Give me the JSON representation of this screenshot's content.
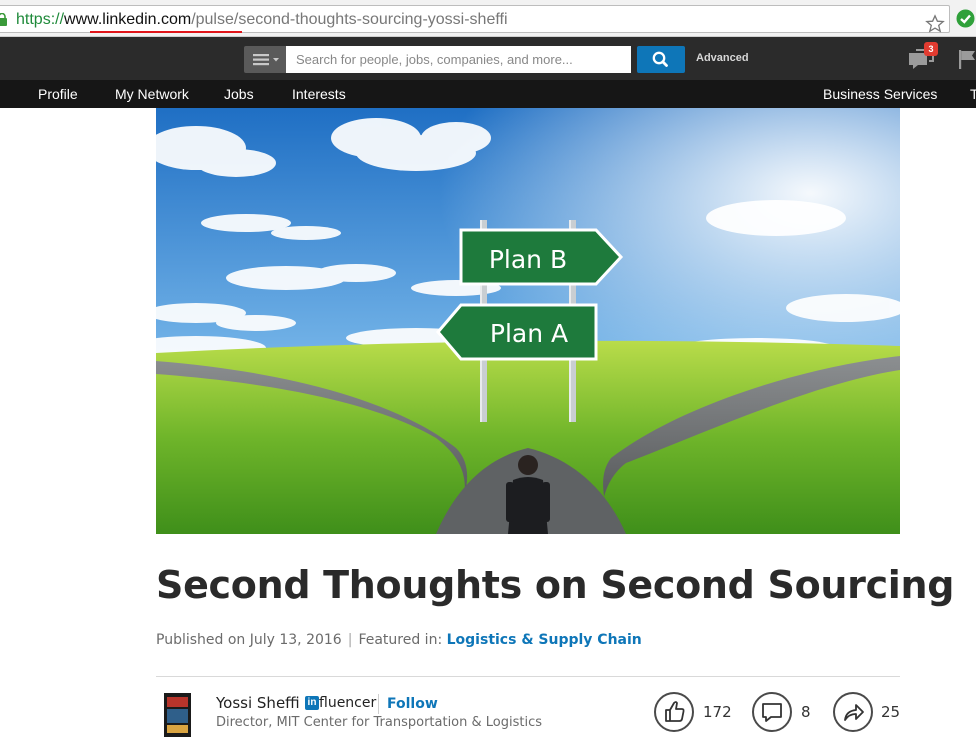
{
  "browser": {
    "url_scheme": "https://",
    "url_host": "www.linkedin.com",
    "url_path": "/pulse/second-thoughts-sourcing-yossi-sheffi"
  },
  "topbar": {
    "search_placeholder": "Search for people, jobs, companies, and more...",
    "advanced_label": "Advanced",
    "messages_badge": "3"
  },
  "nav": {
    "items": [
      "Profile",
      "My Network",
      "Jobs",
      "Interests"
    ],
    "right_item": "Business Services"
  },
  "hero": {
    "sign_top": "Plan B",
    "sign_bottom": "Plan A"
  },
  "article": {
    "title": "Second Thoughts on Second Sourcing",
    "published": "Published on July 13, 2016",
    "separator": "|",
    "featured_label": "Featured in:",
    "featured_link": "Logistics & Supply Chain"
  },
  "author": {
    "name": "Yossi Sheffi",
    "influencer_logo": "in",
    "influencer_suffix": "fluencer",
    "follow_label": "Follow",
    "title": "Director, MIT Center for Transportation & Logistics"
  },
  "actions": {
    "likes": "172",
    "comments": "8",
    "shares": "25"
  },
  "colors": {
    "linkedin_blue": "#0e76b8",
    "topbar": "#2b2b2b",
    "navbar": "#161616",
    "badge": "#e13b30"
  }
}
